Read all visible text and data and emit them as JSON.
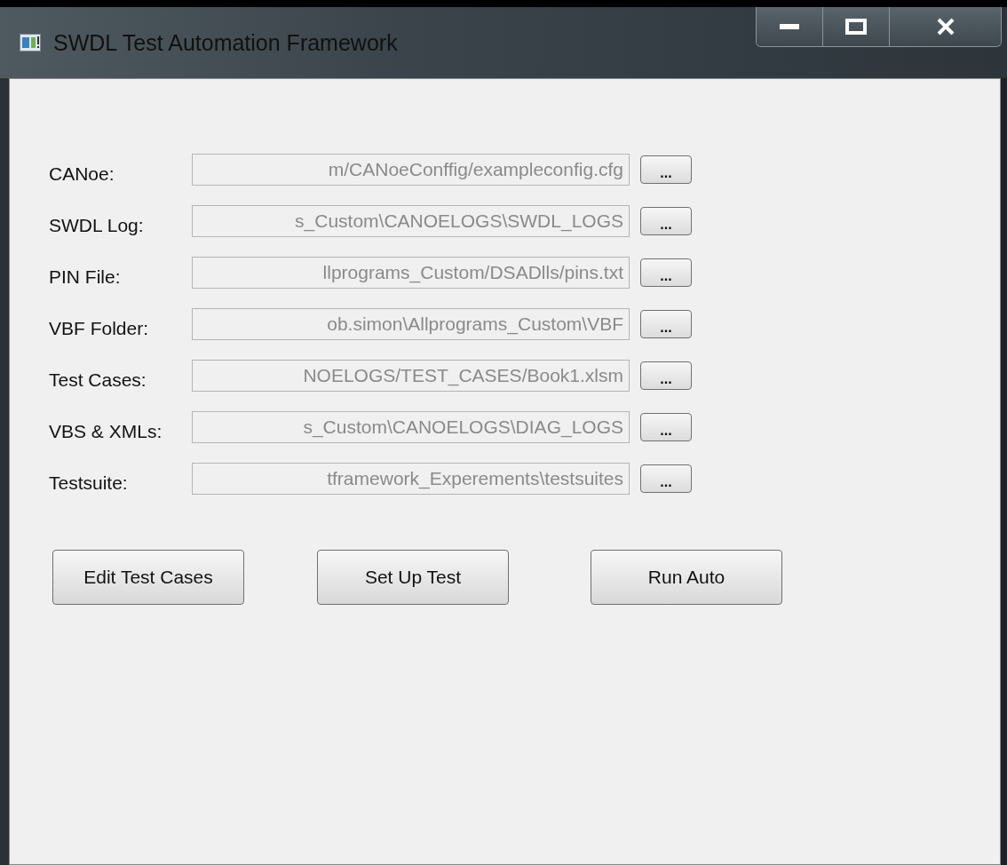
{
  "window": {
    "title": "SWDL Test Automation Framework"
  },
  "fields": [
    {
      "label": "CANoe:",
      "value": "m/CANoeConffig/exampleconfig.cfg",
      "disabled": true,
      "browse": "..."
    },
    {
      "label": "SWDL Log:",
      "value": "s_Custom\\CANOELOGS\\SWDL_LOGS",
      "disabled": true,
      "browse": "..."
    },
    {
      "label": "PIN File:",
      "value": "llprograms_Custom/DSADlls/pins.txt",
      "disabled": true,
      "browse": "..."
    },
    {
      "label": "VBF Folder:",
      "value": "ob.simon\\Allprograms_Custom\\VBF",
      "disabled": true,
      "browse": "..."
    },
    {
      "label": "Test Cases:",
      "value": "NOELOGS/TEST_CASES/Book1.xlsm",
      "disabled": true,
      "browse": "..."
    },
    {
      "label": "VBS & XMLs:",
      "value": "s_Custom\\CANOELOGS\\DIAG_LOGS",
      "disabled": true,
      "browse": "..."
    },
    {
      "label": "Testsuite:",
      "value": "tframework_Experements\\testsuites",
      "disabled": true,
      "browse": "..."
    }
  ],
  "buttons": [
    "Edit Test Cases",
    "Set Up Test",
    "Run Auto"
  ]
}
